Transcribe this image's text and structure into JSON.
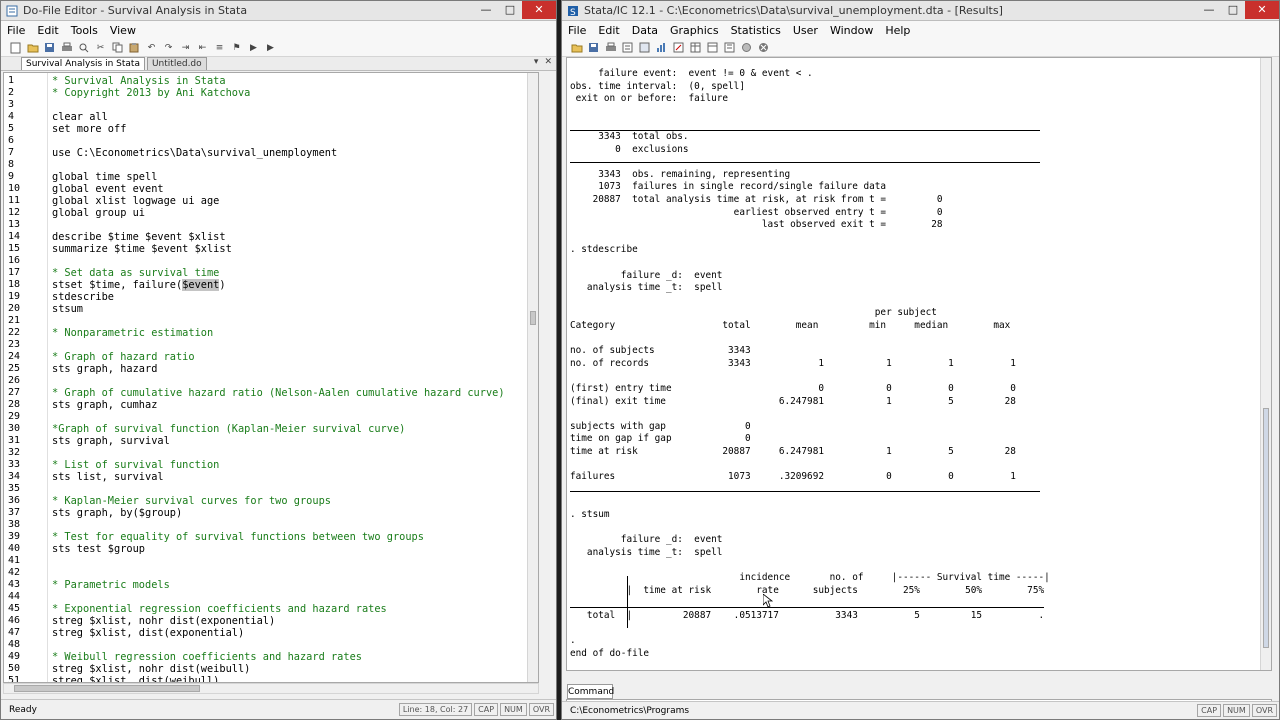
{
  "editor": {
    "window_title": "Do-File Editor - Survival Analysis in Stata",
    "menu": [
      "File",
      "Edit",
      "Tools",
      "View"
    ],
    "tabs": [
      "Survival Analysis in Stata",
      "Untitled.do"
    ],
    "status": {
      "ready": "Ready",
      "position": "Line: 18, Col: 27",
      "cap": "CAP",
      "num": "NUM",
      "ovr": "OVR"
    },
    "lines": [
      {
        "n": "1",
        "text": "* Survival Analysis in Stata",
        "type": "comment"
      },
      {
        "n": "2",
        "text": "* Copyright 2013 by Ani Katchova",
        "type": "comment"
      },
      {
        "n": "3",
        "text": "",
        "type": "code"
      },
      {
        "n": "4",
        "text": "clear all",
        "type": "code"
      },
      {
        "n": "5",
        "text": "set more off",
        "type": "code"
      },
      {
        "n": "6",
        "text": "",
        "type": "code"
      },
      {
        "n": "7",
        "text": "use C:\\Econometrics\\Data\\survival_unemployment",
        "type": "code"
      },
      {
        "n": "8",
        "text": "",
        "type": "code"
      },
      {
        "n": "9",
        "text": "global time spell",
        "type": "code"
      },
      {
        "n": "10",
        "text": "global event event",
        "type": "code"
      },
      {
        "n": "11",
        "text": "global xlist logwage ui age",
        "type": "code"
      },
      {
        "n": "12",
        "text": "global group ui",
        "type": "code"
      },
      {
        "n": "13",
        "text": "",
        "type": "code"
      },
      {
        "n": "14",
        "text": "describe $time $event $xlist",
        "type": "code"
      },
      {
        "n": "15",
        "text": "summarize $time $event $xlist",
        "type": "code"
      },
      {
        "n": "16",
        "text": "",
        "type": "code"
      },
      {
        "n": "17",
        "text": "* Set data as survival time",
        "type": "comment"
      },
      {
        "n": "18",
        "text": "stset $time, failure($event)",
        "type": "code"
      },
      {
        "n": "19",
        "text": "stdescribe",
        "type": "code"
      },
      {
        "n": "20",
        "text": "stsum",
        "type": "code"
      },
      {
        "n": "21",
        "text": "",
        "type": "code"
      },
      {
        "n": "22",
        "text": "* Nonparametric estimation",
        "type": "comment"
      },
      {
        "n": "23",
        "text": "",
        "type": "code"
      },
      {
        "n": "24",
        "text": "* Graph of hazard ratio",
        "type": "comment"
      },
      {
        "n": "25",
        "text": "sts graph, hazard",
        "type": "code"
      },
      {
        "n": "26",
        "text": "",
        "type": "code"
      },
      {
        "n": "27",
        "text": "* Graph of cumulative hazard ratio (Nelson-Aalen cumulative hazard curve)",
        "type": "comment"
      },
      {
        "n": "28",
        "text": "sts graph, cumhaz",
        "type": "code"
      },
      {
        "n": "29",
        "text": "",
        "type": "code"
      },
      {
        "n": "30",
        "text": "*Graph of survival function (Kaplan-Meier survival curve)",
        "type": "comment"
      },
      {
        "n": "31",
        "text": "sts graph, survival",
        "type": "code"
      },
      {
        "n": "32",
        "text": "",
        "type": "code"
      },
      {
        "n": "33",
        "text": "* List of survival function",
        "type": "comment"
      },
      {
        "n": "34",
        "text": "sts list, survival",
        "type": "code"
      },
      {
        "n": "35",
        "text": "",
        "type": "code"
      },
      {
        "n": "36",
        "text": "* Kaplan-Meier survival curves for two groups",
        "type": "comment"
      },
      {
        "n": "37",
        "text": "sts graph, by($group)",
        "type": "code"
      },
      {
        "n": "38",
        "text": "",
        "type": "code"
      },
      {
        "n": "39",
        "text": "* Test for equality of survival functions between two groups",
        "type": "comment"
      },
      {
        "n": "40",
        "text": "sts test $group",
        "type": "code"
      },
      {
        "n": "41",
        "text": "",
        "type": "code"
      },
      {
        "n": "42",
        "text": "",
        "type": "code"
      },
      {
        "n": "43",
        "text": "* Parametric models",
        "type": "comment"
      },
      {
        "n": "44",
        "text": "",
        "type": "code"
      },
      {
        "n": "45",
        "text": "* Exponential regression coefficients and hazard rates",
        "type": "comment"
      },
      {
        "n": "46",
        "text": "streg $xlist, nohr dist(exponential)",
        "type": "code"
      },
      {
        "n": "47",
        "text": "streg $xlist, dist(exponential)",
        "type": "code"
      },
      {
        "n": "48",
        "text": "",
        "type": "code"
      },
      {
        "n": "49",
        "text": "* Weibull regression coefficients and hazard rates",
        "type": "comment"
      },
      {
        "n": "50",
        "text": "streg $xlist, nohr dist(weibull)",
        "type": "code"
      },
      {
        "n": "51",
        "text": "streg $xlist, dist(weibull)",
        "type": "code"
      }
    ]
  },
  "results": {
    "window_title": "Stata/IC 12.1 - C:\\Econometrics\\Data\\survival_unemployment.dta - [Results]",
    "menu": [
      "File",
      "Edit",
      "Data",
      "Graphics",
      "Statistics",
      "User",
      "Window",
      "Help"
    ],
    "command_tab": "Command",
    "cwd": "C:\\Econometrics\\Programs",
    "status": {
      "cap": "CAP",
      "num": "NUM",
      "ovr": "OVR"
    },
    "lines": [
      "     failure event:  event != 0 & event < .",
      "obs. time interval:  (0, spell]",
      " exit on or before:  failure",
      "",
      "",
      "     3343  total obs.",
      "        0  exclusions",
      "",
      "     3343  obs. remaining, representing",
      "     1073  failures in single record/single failure data",
      "    20887  total analysis time at risk, at risk from t =         0",
      "                             earliest observed entry t =         0",
      "                                  last observed exit t =        28",
      "",
      ". stdescribe",
      "",
      "         failure _d:  event",
      "   analysis time _t:  spell",
      "",
      "                                                      per subject",
      "Category                   total        mean         min     median        max",
      "",
      "no. of subjects             3343",
      "no. of records              3343            1           1          1          1",
      "",
      "(first) entry time                          0           0          0          0",
      "(final) exit time                    6.247981           1          5         28",
      "",
      "subjects with gap              0",
      "time on gap if gap             0",
      "time at risk               20887     6.247981           1          5         28",
      "",
      "failures                    1073     .3209692           0          0          1",
      "",
      "",
      ". stsum",
      "",
      "         failure _d:  event",
      "   analysis time _t:  spell",
      "",
      "                              incidence       no. of     |------ Survival time -----|",
      "          |  time at risk        rate      subjects        25%        50%        75%",
      "",
      "   total  |         20887    .0513717          3343          5         15          .",
      "",
      ".",
      "end of do-file"
    ]
  }
}
